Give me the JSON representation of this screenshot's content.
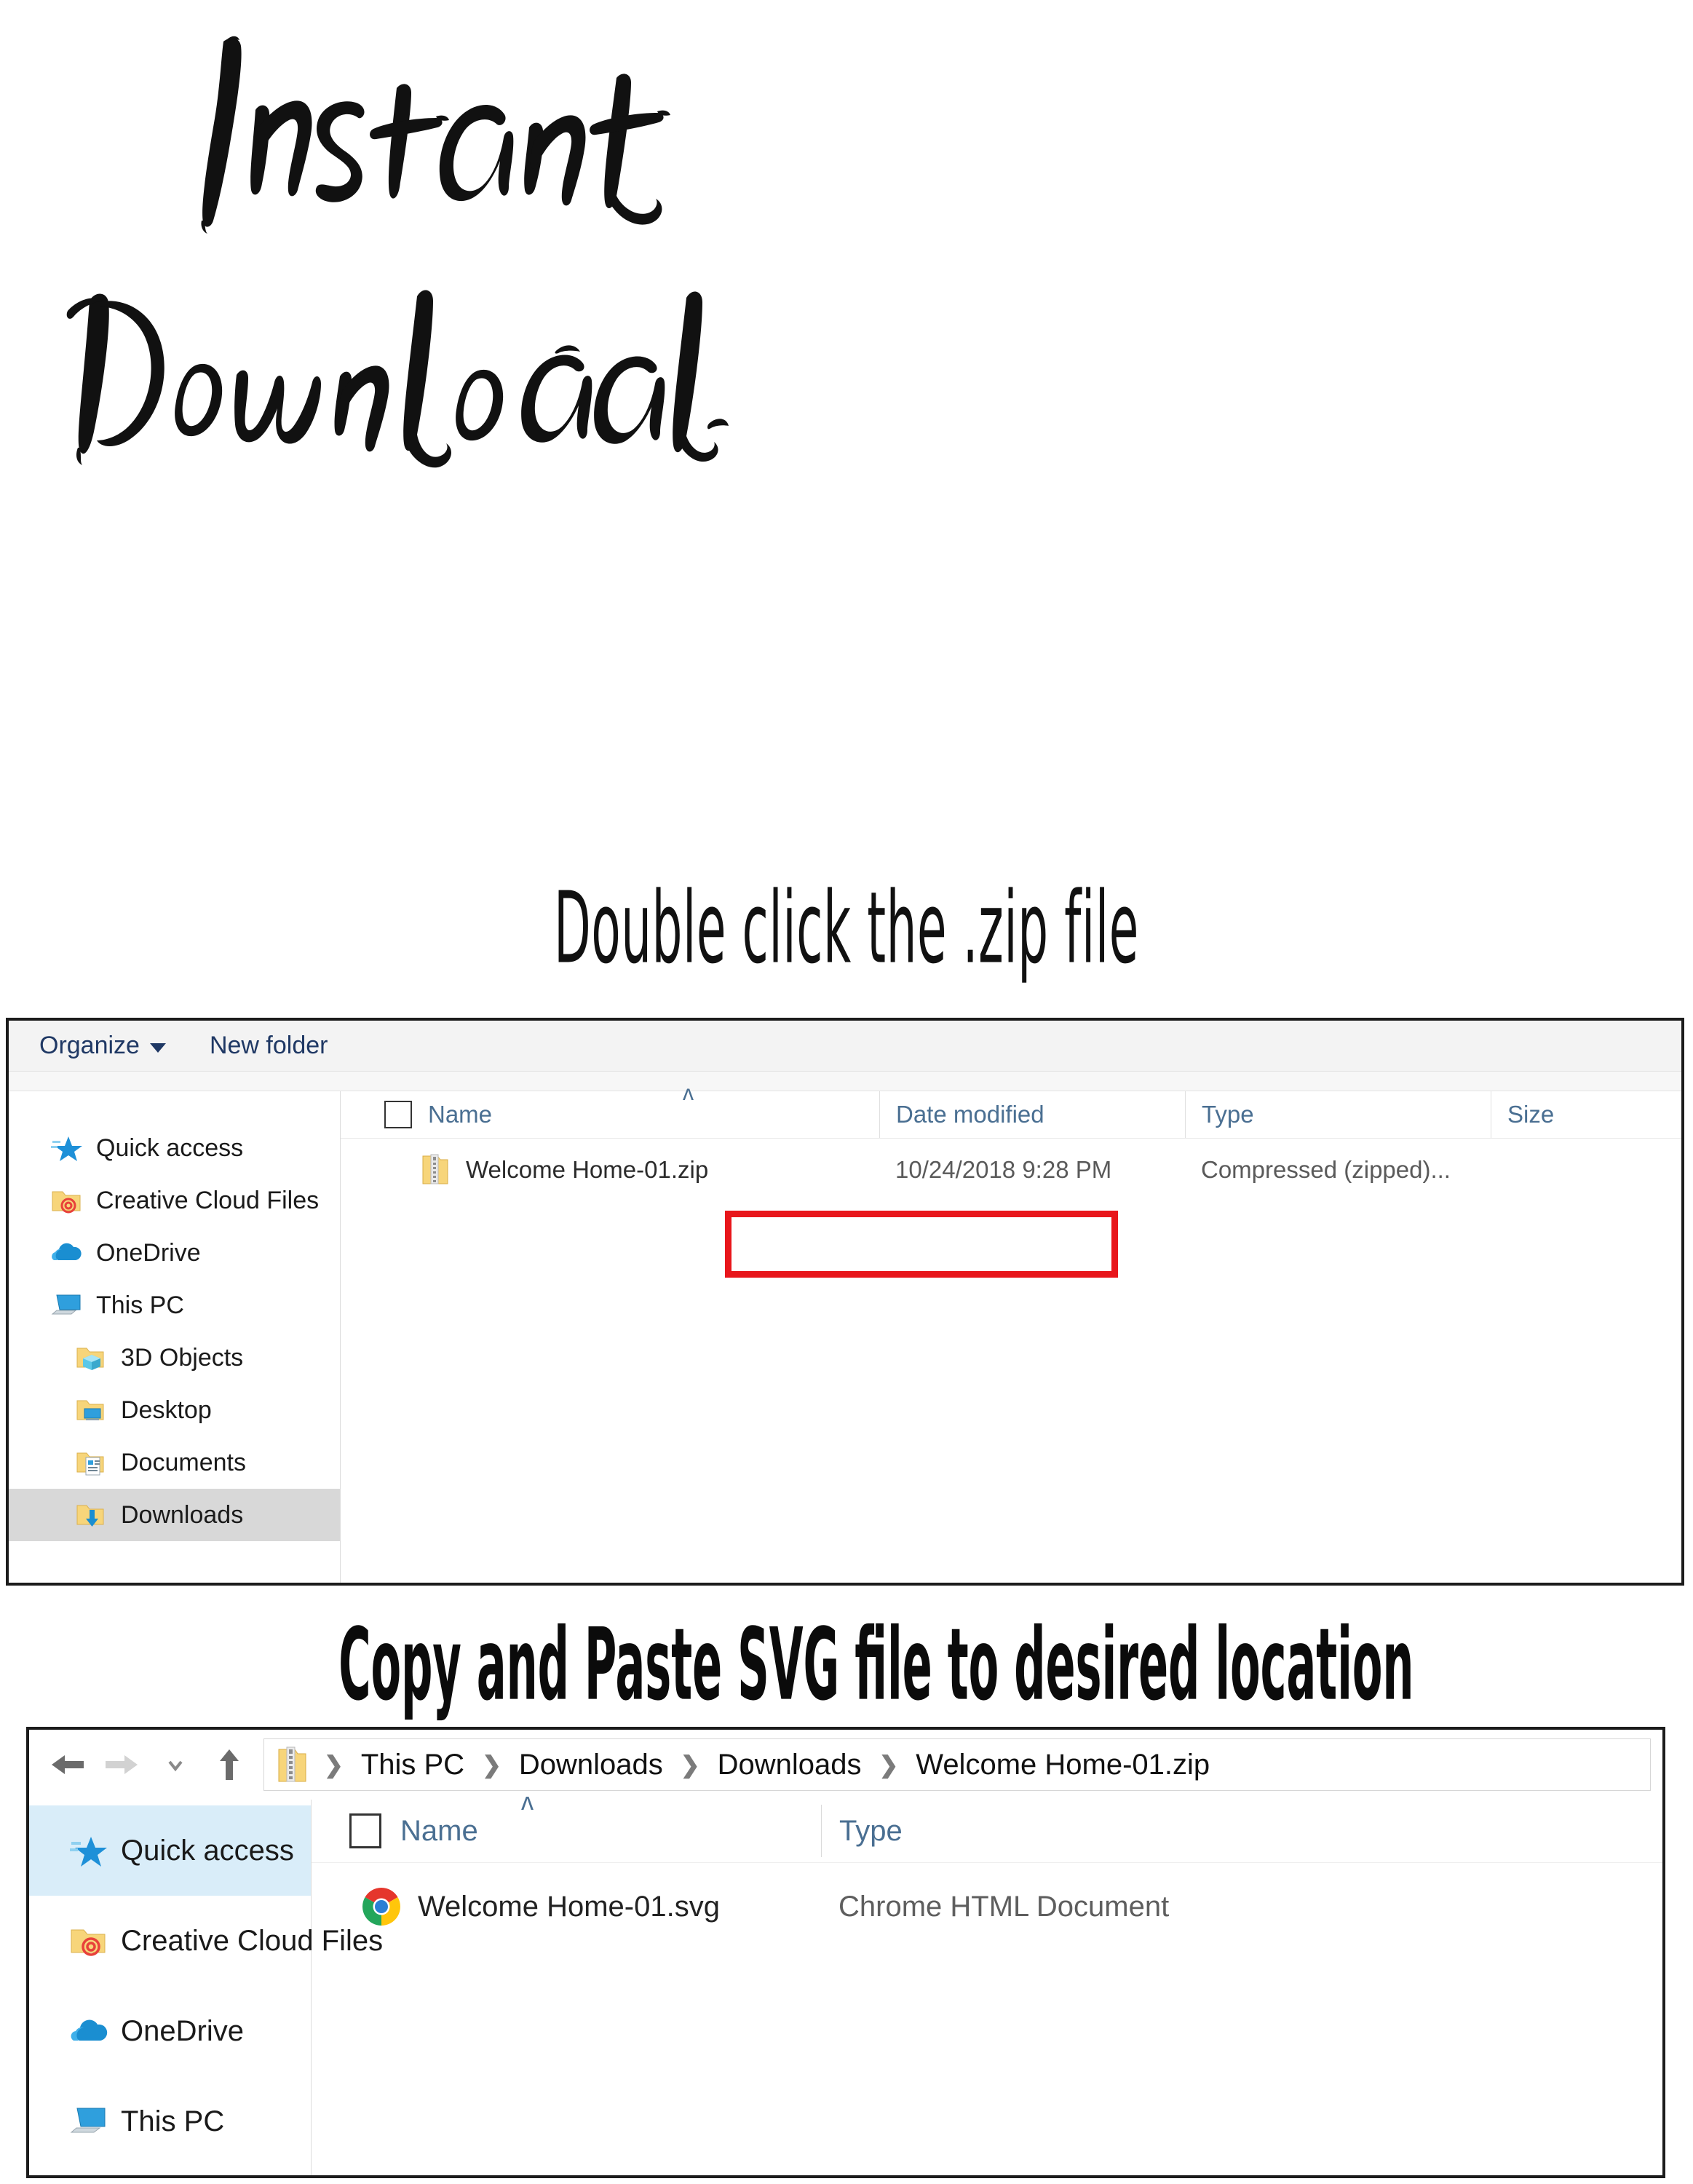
{
  "hero": {
    "line1": "Instant",
    "line2": "Download",
    "tagline1": "Double click the .zip file",
    "tagline2": "Copy and Paste SVG file to desired location"
  },
  "explorer1": {
    "toolbar": {
      "organize_label": "Organize",
      "new_folder_label": "New folder"
    },
    "nav_pane": [
      {
        "label": "Quick access",
        "icon": "star-icon",
        "indent": false,
        "selected": false
      },
      {
        "label": "Creative Cloud Files",
        "icon": "creative-cloud-folder-icon",
        "indent": false,
        "selected": false
      },
      {
        "label": "OneDrive",
        "icon": "onedrive-cloud-icon",
        "indent": false,
        "selected": false
      },
      {
        "label": "This PC",
        "icon": "this-pc-monitor-icon",
        "indent": false,
        "selected": false
      },
      {
        "label": "3D Objects",
        "icon": "3d-objects-folder-icon",
        "indent": true,
        "selected": false
      },
      {
        "label": "Desktop",
        "icon": "desktop-folder-icon",
        "indent": true,
        "selected": false
      },
      {
        "label": "Documents",
        "icon": "documents-folder-icon",
        "indent": true,
        "selected": false
      },
      {
        "label": "Downloads",
        "icon": "downloads-folder-icon",
        "indent": true,
        "selected": true
      }
    ],
    "columns": [
      {
        "label": "Name"
      },
      {
        "label": "Date modified"
      },
      {
        "label": "Type"
      },
      {
        "label": "Size"
      }
    ],
    "sort_indicator": "ʌ",
    "rows": [
      {
        "name": "Welcome Home-01.zip",
        "icon": "zip-folder-icon",
        "date_modified": "10/24/2018 9:28 PM",
        "type": "Compressed (zipped)...",
        "size": "",
        "highlight_color": "#e8161b"
      }
    ]
  },
  "explorer2": {
    "nav_buttons": [
      {
        "icon": "back-arrow-icon",
        "glyph": "←",
        "enabled": true
      },
      {
        "icon": "forward-arrow-icon",
        "glyph": "→",
        "enabled": false
      },
      {
        "icon": "recent-locations-chevron-icon",
        "glyph": "ˇ",
        "enabled": false
      },
      {
        "icon": "up-arrow-icon",
        "glyph": "↑",
        "enabled": true
      }
    ],
    "breadcrumb": {
      "icon": "zip-folder-icon",
      "separator": "❯",
      "items": [
        "This PC",
        "Downloads",
        "Downloads",
        "Welcome Home-01.zip"
      ]
    },
    "nav_pane": [
      {
        "label": "Quick access",
        "icon": "star-icon",
        "selected": true
      },
      {
        "label": "Creative Cloud Files",
        "icon": "creative-cloud-folder-icon",
        "selected": false
      },
      {
        "label": "OneDrive",
        "icon": "onedrive-cloud-icon",
        "selected": false
      },
      {
        "label": "This PC",
        "icon": "this-pc-monitor-icon",
        "selected": false
      }
    ],
    "columns": [
      {
        "label": "Name"
      },
      {
        "label": "Type"
      }
    ],
    "sort_indicator": "ʌ",
    "rows": [
      {
        "name": "Welcome Home-01.svg",
        "icon": "chrome-icon",
        "type": "Chrome HTML Document"
      }
    ]
  },
  "colors": {
    "highlight_red": "#e8161b",
    "selection_blue": "#d9edf9",
    "selection_gray": "#d8d8d8",
    "header_text": "#4a6f92",
    "toolbar_text": "#1f3864"
  }
}
